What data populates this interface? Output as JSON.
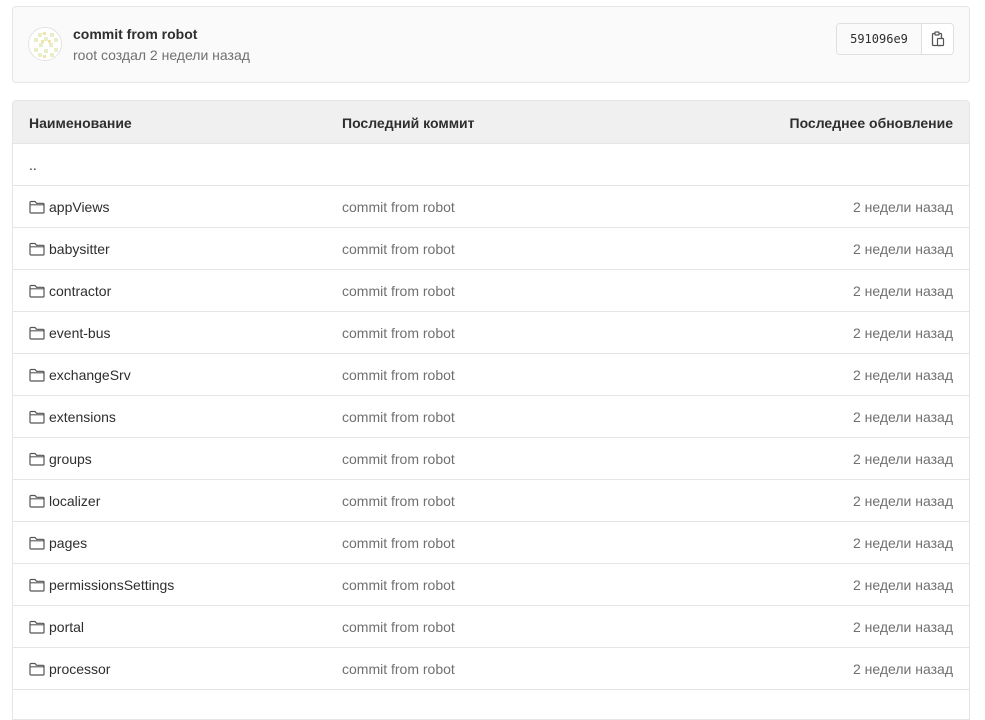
{
  "commit": {
    "title": "commit from robot",
    "meta": "root создал 2 недели назад",
    "sha": "591096e9"
  },
  "table": {
    "headers": {
      "name": "Наименование",
      "last_commit": "Последний коммит",
      "last_update": "Последнее обновление"
    },
    "parent_link": "..",
    "rows": [
      {
        "name": "appViews",
        "commit": "commit from robot",
        "updated": "2 недели назад"
      },
      {
        "name": "babysitter",
        "commit": "commit from robot",
        "updated": "2 недели назад"
      },
      {
        "name": "contractor",
        "commit": "commit from robot",
        "updated": "2 недели назад"
      },
      {
        "name": "event-bus",
        "commit": "commit from robot",
        "updated": "2 недели назад"
      },
      {
        "name": "exchangeSrv",
        "commit": "commit from robot",
        "updated": "2 недели назад"
      },
      {
        "name": "extensions",
        "commit": "commit from robot",
        "updated": "2 недели назад"
      },
      {
        "name": "groups",
        "commit": "commit from robot",
        "updated": "2 недели назад"
      },
      {
        "name": "localizer",
        "commit": "commit from robot",
        "updated": "2 недели назад"
      },
      {
        "name": "pages",
        "commit": "commit from robot",
        "updated": "2 недели назад"
      },
      {
        "name": "permissionsSettings",
        "commit": "commit from robot",
        "updated": "2 недели назад"
      },
      {
        "name": "portal",
        "commit": "commit from robot",
        "updated": "2 недели назад"
      },
      {
        "name": "processor",
        "commit": "commit from robot",
        "updated": "2 недели назад"
      }
    ]
  },
  "icons": {
    "folder": "folder-icon",
    "copy": "clipboard-icon",
    "avatar": "identicon-avatar"
  }
}
